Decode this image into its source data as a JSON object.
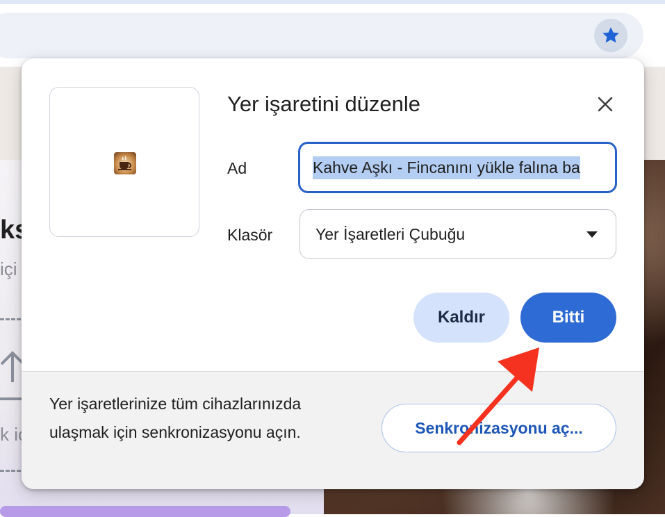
{
  "browser": {
    "star_icon": "star-icon",
    "accent": "#1f63d6"
  },
  "background_page": {
    "heading_fragment": "ks",
    "subtext_fragment": "içi",
    "lower_fragment": "k iç"
  },
  "dialog": {
    "title": "Yer işaretini düzenle",
    "close_icon": "close-icon",
    "name_label": "Ad",
    "name_value": "Kahve Aşkı - Fincanını yükle falına bakalım",
    "name_visible": "Kahve Aşkı - Fincanını yükle falına ba",
    "folder_label": "Klasör",
    "folder_value": "Yer İşaretleri Çubuğu",
    "remove_label": "Kaldır",
    "done_label": "Bitti",
    "colors": {
      "done_bg": "#2f6bd4",
      "remove_bg": "#d4e2fb",
      "focus_border": "#2862c9"
    }
  },
  "footer": {
    "message": "Yer işaretlerinize tüm cihazlarınızda ulaşmak için senkronizasyonu açın.",
    "sync_label": "Senkronizasyonu aç..."
  },
  "annotation": {
    "arrow_color": "#f4321f"
  }
}
